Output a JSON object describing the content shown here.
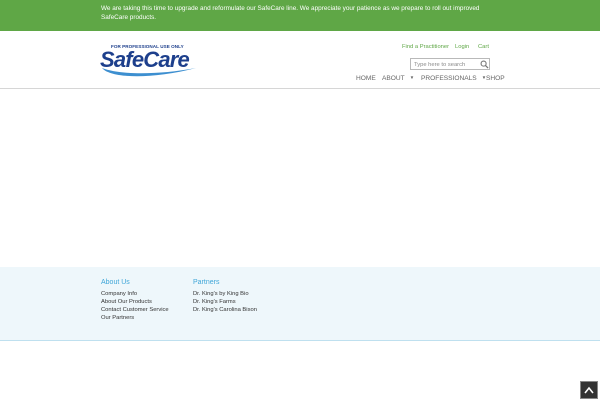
{
  "banner": {
    "message": "We are taking this time to upgrade and reformulate our SafeCare line. We appreciate your patience as we prepare to roll out improved SafeCare products."
  },
  "header": {
    "logo": {
      "tagline": "FOR PROFESSIONAL USE ONLY",
      "wordmark": "SafeCare"
    },
    "top_links": [
      "Find a Practitioner",
      "Login",
      "Cart"
    ],
    "search": {
      "placeholder": "Type here to search",
      "value": ""
    },
    "nav": [
      {
        "label": "HOME",
        "has_dropdown": false
      },
      {
        "label": "ABOUT",
        "has_dropdown": true
      },
      {
        "label": "PROFESSIONALS",
        "has_dropdown": true
      },
      {
        "label": "SHOP",
        "has_dropdown": false
      }
    ]
  },
  "footer": {
    "columns": [
      {
        "title": "About Us",
        "links": [
          "Company Info",
          "About Our Products",
          "Contact Customer Service",
          "Our Partners"
        ]
      },
      {
        "title": "Partners",
        "links": [
          "Dr. King's by King Bio",
          "Dr. King's Farms",
          "Dr. King's Carolina Bison"
        ]
      }
    ]
  },
  "icons": {
    "search": "search-icon",
    "caret": "caret-down-icon",
    "back_to_top": "chevron-up-icon"
  },
  "colors": {
    "banner_bg": "#5fa746",
    "link_green": "#5fa746",
    "brand_blue": "#1d3f8c",
    "footer_bg": "#eef7fb",
    "footer_heading": "#3fa6d8"
  }
}
